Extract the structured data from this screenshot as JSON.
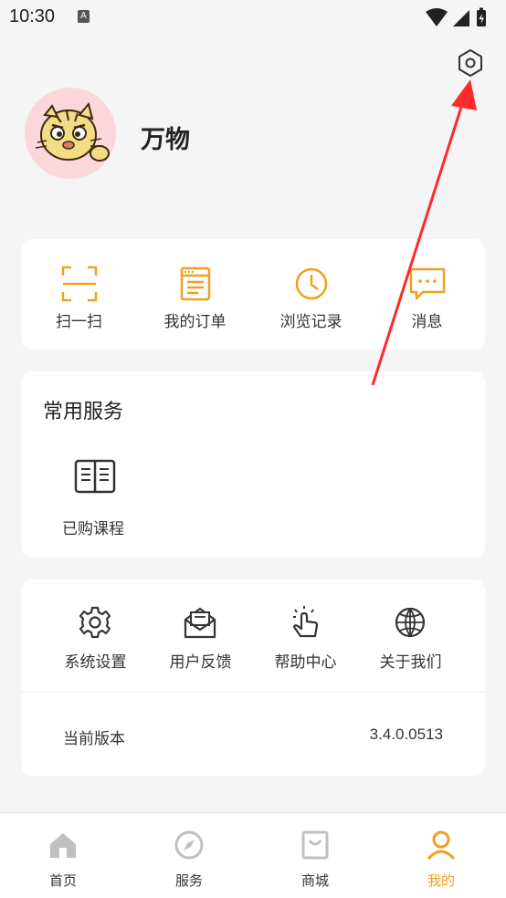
{
  "status_bar": {
    "time": "10:30",
    "notification_badge": "A"
  },
  "profile": {
    "username": "万物"
  },
  "quick_actions": [
    {
      "label": "扫一扫",
      "icon": "scan-icon"
    },
    {
      "label": "我的订单",
      "icon": "order-icon"
    },
    {
      "label": "浏览记录",
      "icon": "clock-icon"
    },
    {
      "label": "消息",
      "icon": "message-icon"
    }
  ],
  "services": {
    "title": "常用服务",
    "items": [
      {
        "label": "已购课程",
        "icon": "book-icon"
      }
    ]
  },
  "tools": {
    "items": [
      {
        "label": "系统设置",
        "icon": "gear-icon"
      },
      {
        "label": "用户反馈",
        "icon": "mail-icon"
      },
      {
        "label": "帮助中心",
        "icon": "tap-icon"
      },
      {
        "label": "关于我们",
        "icon": "globe-icon"
      }
    ],
    "version_label": "当前版本",
    "version_value": "3.4.0.0513"
  },
  "bottom_nav": [
    {
      "label": "首页",
      "icon": "home-icon"
    },
    {
      "label": "服务",
      "icon": "compass-icon"
    },
    {
      "label": "商城",
      "icon": "shop-icon"
    },
    {
      "label": "我的",
      "icon": "user-icon",
      "active": true
    }
  ],
  "colors": {
    "accent": "#f0a020",
    "arrow": "#ff2a2a",
    "icon_gray": "#bbbbbb",
    "background": "#f5f5f5"
  }
}
